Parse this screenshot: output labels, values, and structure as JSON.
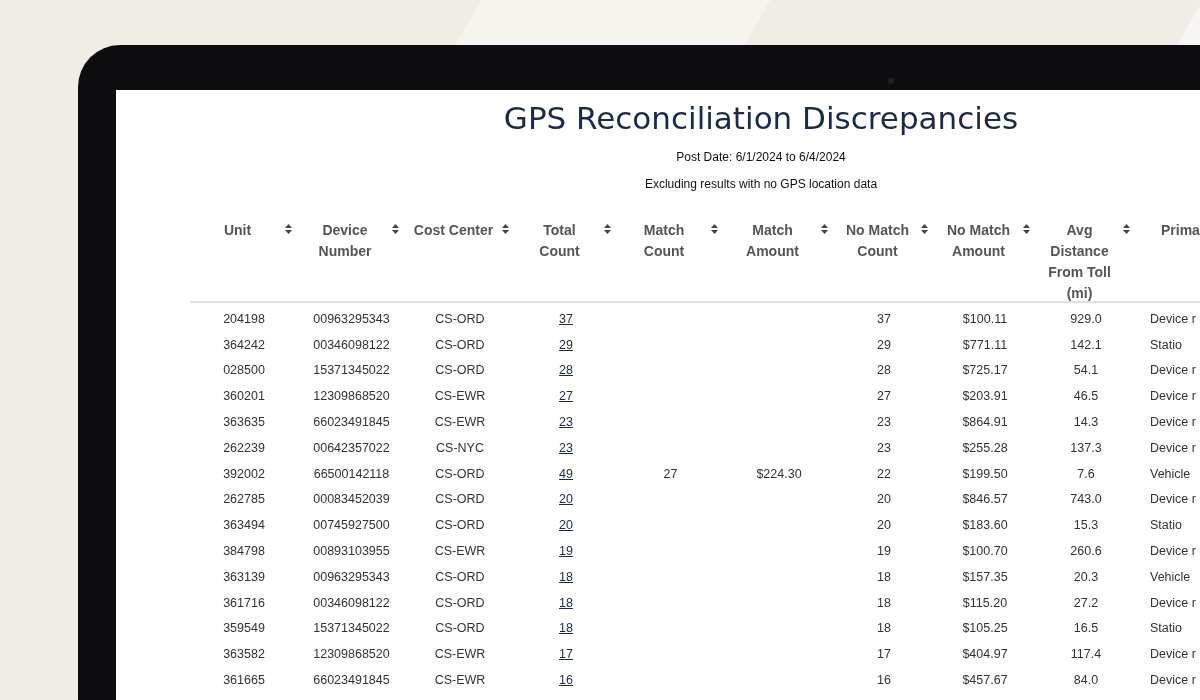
{
  "report": {
    "title": "GPS Reconciliation Discrepancies",
    "post_date": "Post Date: 6/1/2024 to 6/4/2024",
    "note": "Excluding results with no GPS location data"
  },
  "table": {
    "columns": [
      {
        "label": "Unit",
        "sortable": true
      },
      {
        "label": "Device Number",
        "sortable": true
      },
      {
        "label": "Cost Center",
        "sortable": true
      },
      {
        "label": "Total Count",
        "sortable": true
      },
      {
        "label": "Match Count",
        "sortable": true
      },
      {
        "label": "Match Amount",
        "sortable": true
      },
      {
        "label": "No Match Count",
        "sortable": true
      },
      {
        "label": "No Match Amount",
        "sortable": true
      },
      {
        "label": "Avg Distance From Toll (mi)",
        "sortable": true
      },
      {
        "label": "Prima",
        "sortable": false
      }
    ],
    "rows": [
      {
        "unit": "204198",
        "device_number": "00963295343",
        "cost_center": "CS-ORD",
        "total_count": "37",
        "no_match_count": "37",
        "no_match_amount": "$100.11",
        "avg_distance": "929.0",
        "primary": "Device r"
      },
      {
        "unit": "364242",
        "device_number": "00346098122",
        "cost_center": "CS-ORD",
        "total_count": "29",
        "no_match_count": "29",
        "no_match_amount": "$771.11",
        "avg_distance": "142.1",
        "primary": "Statio"
      },
      {
        "unit": "028500",
        "device_number": "15371345022",
        "cost_center": "CS-ORD",
        "total_count": "28",
        "no_match_count": "28",
        "no_match_amount": "$725.17",
        "avg_distance": "54.1",
        "primary": "Device r"
      },
      {
        "unit": "360201",
        "device_number": "12309868520",
        "cost_center": "CS-EWR",
        "total_count": "27",
        "no_match_count": "27",
        "no_match_amount": "$203.91",
        "avg_distance": "46.5",
        "primary": "Device r"
      },
      {
        "unit": "363635",
        "device_number": "66023491845",
        "cost_center": "CS-EWR",
        "total_count": "23",
        "no_match_count": "23",
        "no_match_amount": "$864.91",
        "avg_distance": "14.3",
        "primary": "Device r"
      },
      {
        "unit": "262239",
        "device_number": "00642357022",
        "cost_center": "CS-NYC",
        "total_count": "23",
        "no_match_count": "23",
        "no_match_amount": "$255.28",
        "avg_distance": "137.3",
        "primary": "Device r"
      },
      {
        "unit": "392002",
        "device_number": "66500142118",
        "cost_center": "CS-ORD",
        "total_count": "49",
        "match_count": "27",
        "match_amount": "$224.30",
        "no_match_count": "22",
        "no_match_amount": "$199.50",
        "avg_distance": "7.6",
        "primary": "Vehicle"
      },
      {
        "unit": "262785",
        "device_number": "00083452039",
        "cost_center": "CS-ORD",
        "total_count": "20",
        "no_match_count": "20",
        "no_match_amount": "$846.57",
        "avg_distance": "743.0",
        "primary": "Device r"
      },
      {
        "unit": "363494",
        "device_number": "00745927500",
        "cost_center": "CS-ORD",
        "total_count": "20",
        "no_match_count": "20",
        "no_match_amount": "$183.60",
        "avg_distance": "15.3",
        "primary": "Statio"
      },
      {
        "unit": "384798",
        "device_number": "00893103955",
        "cost_center": "CS-EWR",
        "total_count": "19",
        "no_match_count": "19",
        "no_match_amount": "$100.70",
        "avg_distance": "260.6",
        "primary": "Device r"
      },
      {
        "unit": "363139",
        "device_number": "00963295343",
        "cost_center": "CS-ORD",
        "total_count": "18",
        "no_match_count": "18",
        "no_match_amount": "$157.35",
        "avg_distance": "20.3",
        "primary": "Vehicle"
      },
      {
        "unit": "361716",
        "device_number": "00346098122",
        "cost_center": "CS-ORD",
        "total_count": "18",
        "no_match_count": "18",
        "no_match_amount": "$115.20",
        "avg_distance": "27.2",
        "primary": "Device r"
      },
      {
        "unit": "359549",
        "device_number": "15371345022",
        "cost_center": "CS-ORD",
        "total_count": "18",
        "no_match_count": "18",
        "no_match_amount": "$105.25",
        "avg_distance": "16.5",
        "primary": "Statio"
      },
      {
        "unit": "363582",
        "device_number": "12309868520",
        "cost_center": "CS-EWR",
        "total_count": "17",
        "no_match_count": "17",
        "no_match_amount": "$404.97",
        "avg_distance": "117.4",
        "primary": "Device r"
      },
      {
        "unit": "361665",
        "device_number": "66023491845",
        "cost_center": "CS-EWR",
        "total_count": "16",
        "no_match_count": "16",
        "no_match_amount": "$457.67",
        "avg_distance": "84.0",
        "primary": "Device r"
      }
    ]
  }
}
